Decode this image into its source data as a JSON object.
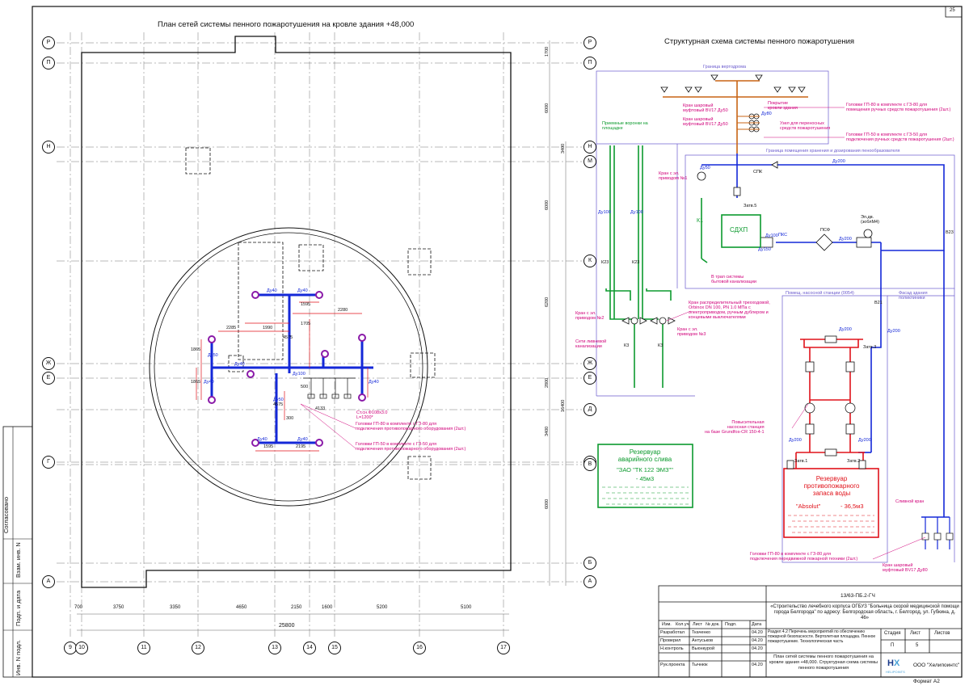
{
  "sheet": {
    "number": "25",
    "format": "Формат А2",
    "side_labels": [
      "Согласовано",
      "Взам. инв. N",
      "Подп. и дата",
      "Инв. N подл."
    ]
  },
  "plan": {
    "title": "План сетей системы пенного пожаротушения на кровле здания +48,000",
    "row_axes": [
      "Р",
      "П",
      "Н",
      "М",
      "К",
      "Ж",
      "Е",
      "Д",
      "Г",
      "В",
      "Б",
      "А"
    ],
    "col_axes": [
      "9",
      "10",
      "11",
      "12",
      "13",
      "14",
      "15",
      "16",
      "17"
    ],
    "bottom_dims": [
      "700",
      "3750",
      "3350",
      "4650",
      "2150",
      "1600",
      "5200",
      "5100"
    ],
    "total_dim": "25800",
    "right_dims": [
      "1700",
      "6000",
      "3400",
      "6000",
      "6200",
      "2800",
      "3400",
      "6000",
      "16400"
    ],
    "pipe_labels": [
      "Ду40",
      "Ду40",
      "Ду50",
      "Ду40",
      "Ду100",
      "Ду50",
      "Ду40",
      "Ду40",
      "Ду40",
      "Ду40"
    ],
    "dims": [
      "1595",
      "1990",
      "2280",
      "2285",
      "4575",
      "1705",
      "1865",
      "1865",
      "4575",
      "1595",
      "2195",
      "300",
      "500",
      "4133"
    ],
    "notes": [
      "Ст.сн.Ф108х3.0\nL=1200*",
      "Головки ГП-80 в комплекте с ГЗ-80 для\nподключения противопожарного оборудования (2шт.)",
      "Головки ГП-50 в комплекте с ГЗ-50 для\nподключения противопожарного оборудования (2шт.)"
    ]
  },
  "scheme": {
    "title": "Структурная схема системы пенного пожаротушения",
    "zones": [
      "Граница вертодрома",
      "Граница помещения хранения и дозирования пенообразователя",
      "Помещ. насосной станции (0054)",
      "Фасад здания поликлиники"
    ],
    "labels": {
      "sdhp": "СДХП",
      "spk": "СПК",
      "psf": "ПСФ",
      "pks": "ПКС",
      "k1": "К1",
      "k23a": "К23",
      "k23b": "К23",
      "k3a": "К3",
      "k3b": "К3",
      "v23": "В23",
      "v21": "В21",
      "kr1": "Кран с эл.\nприводом №1",
      "kr2": "Кран с эл.\nприводом №2",
      "kr3": "Кран с эл.\nприводом №3",
      "eldv": "Эл.дв.\n(зоблМ4)",
      "zatv1": "Затв.1",
      "zatv2": "Затв.2",
      "zatv3": "Затв.3",
      "zatv5": "Затв.5",
      "trap": "Приемные воронки на\nплощадке",
      "ktrap": "В трап системы\nбытовой канализации",
      "kseti": "Сети ливневой\nканализации",
      "valves": "Кран распределительный трехходовой,\nOrbinox DN 100, PN 1.0 МПа с\nэлектроприводом, ручным дублером и\nконцевыми выключателями",
      "pump": "Повысительная\nнасосная станция\nна базе Grundfos-CR 150-4-1",
      "pokr": "Покрытие\nкровли здания",
      "uzel": "Узел для переносных\nсредств пожаротушения",
      "kran_sh1": "Кран шаровый\nмуфтовый BV17 Ду50",
      "kran_sh2": "Кран шаровый\nмуфтовый BV17 Ду50",
      "gol80": "Головки ГП-80 в комплекте с ГЗ-80 для\nпомещения ручных средств пожаротушения (2шт.)",
      "gol50": "Головки ГП-50 в комплекте с ГЗ-50 для\nподключения ручных средств пожаротушения (2шт.)",
      "gol80b": "Головки ГП-80 в комплекте с ГЗ-80 для\nподключения передвижной пожарной техники (2шт.)",
      "kran_sh3": "Кран шаровый\nмуфтовый BV17 Ду80",
      "sliv": "Сливной кран",
      "du": [
        "Ду200",
        "Ду200",
        "Ду100",
        "Ду200",
        "Ду200",
        "Ду150",
        "Ду200",
        "Ду200",
        "Ду100",
        "Ду100",
        "Ду50",
        "Ду80"
      ]
    },
    "tank1": {
      "title": "Резервуар\nаварийного слива",
      "name": "\"ЗАО \"ТК 122 ЭМЗ\"\"",
      "volume": "- 45м3"
    },
    "tank2": {
      "title": "Резервуар\nпротивопожарного\nзапаса воды",
      "name": "\"Absolut\"",
      "volume": "- 36,5м3"
    }
  },
  "title_block": {
    "code": "13/63-ПБ.2-ГЧ",
    "project": "«Строительство лечебного корпуса ОГБУЗ \"Больница скорой медицинской помощи города Белгорода\" по адресу: Белгородская область, г. Белгород, ул. Губкина, д. 46»",
    "section": "Раздел 4.2 Перечень мероприятий по обеспечению пожарной безопасности. Вертолетная площадка. Пенное пожаротушение. Технологическая часть",
    "sheet_name": "План сетей системы пенного пожаротушения на кровле здания +48,000. Структурная схема системы пенного пожаротушения",
    "stage_h": "Стадия",
    "sheet_h": "Лист",
    "sheets_h": "Листов",
    "stage": "П",
    "sheet_no": "5",
    "sheets": "",
    "company": "ООО \"Хелипоинтс\"",
    "logo": "HELIPOINTS",
    "head": [
      "Изм.",
      "Кол.уч",
      "Лист",
      "№ док.",
      "Подп.",
      "Дата"
    ],
    "rows": [
      {
        "role": "Разработал",
        "name": "Ткаченко",
        "date": "04.20"
      },
      {
        "role": "Проверил",
        "name": "Антуськов",
        "date": "04.20"
      },
      {
        "role": "Н.контроль",
        "name": "Вьюнкурой",
        "date": "04.20"
      },
      {
        "role": "Рук.проекта",
        "name": "Тычнюк",
        "date": "04.20"
      }
    ]
  },
  "colors": {
    "blue": "#1428d8",
    "green": "#0c9a2e",
    "red": "#e0121a",
    "pink": "#d0007a",
    "orange": "#c86414",
    "frame": "#111111"
  }
}
